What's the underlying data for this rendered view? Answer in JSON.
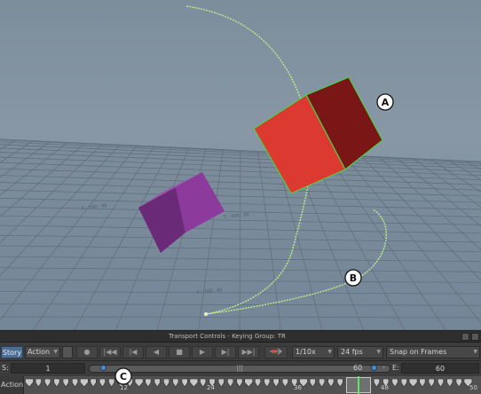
{
  "viewport": {
    "callouts": [
      {
        "label": "A"
      },
      {
        "label": "B"
      },
      {
        "label": "C"
      }
    ],
    "colors": {
      "red_cube_front": "#dc3a30",
      "red_cube_side": "#7a1616",
      "selection_outline": "#4cd24c",
      "purple_cube_front": "#8c3a9c",
      "purple_cube_side": "#6a2a78",
      "trajectory": "#c6f28c",
      "grid_line": "#5e6d7a"
    },
    "ground_annotations": [
      "5 : 100 : 50",
      "5 : 100 : 40",
      "5 : 100 : 30"
    ]
  },
  "transport": {
    "title": "Transport Controls  -  Keying Group: TR",
    "toolbar": {
      "story_tab": "Story",
      "action_dropdown": "Action",
      "playback_buttons": [
        {
          "name": "record-icon",
          "glyph": "●"
        },
        {
          "name": "goto-start-icon",
          "glyph": "|◀◀"
        },
        {
          "name": "prev-key-icon",
          "glyph": "|◀"
        },
        {
          "name": "play-back-icon",
          "glyph": "◀"
        },
        {
          "name": "stop-icon",
          "glyph": "■"
        },
        {
          "name": "play-forward-icon",
          "glyph": "▶"
        },
        {
          "name": "next-key-icon",
          "glyph": "▶|"
        },
        {
          "name": "goto-end-icon",
          "glyph": "▶▶|"
        }
      ],
      "speed": "1/10x",
      "fps": "24 fps",
      "snap": "Snap on Frames"
    },
    "range": {
      "start_label": "S:",
      "start_value": "1",
      "current_value": "60",
      "end_label": "E:",
      "end_value": "60"
    },
    "timeline": {
      "label": "Action",
      "ticks": [
        "12",
        "24",
        "36",
        "48",
        "50"
      ]
    }
  }
}
